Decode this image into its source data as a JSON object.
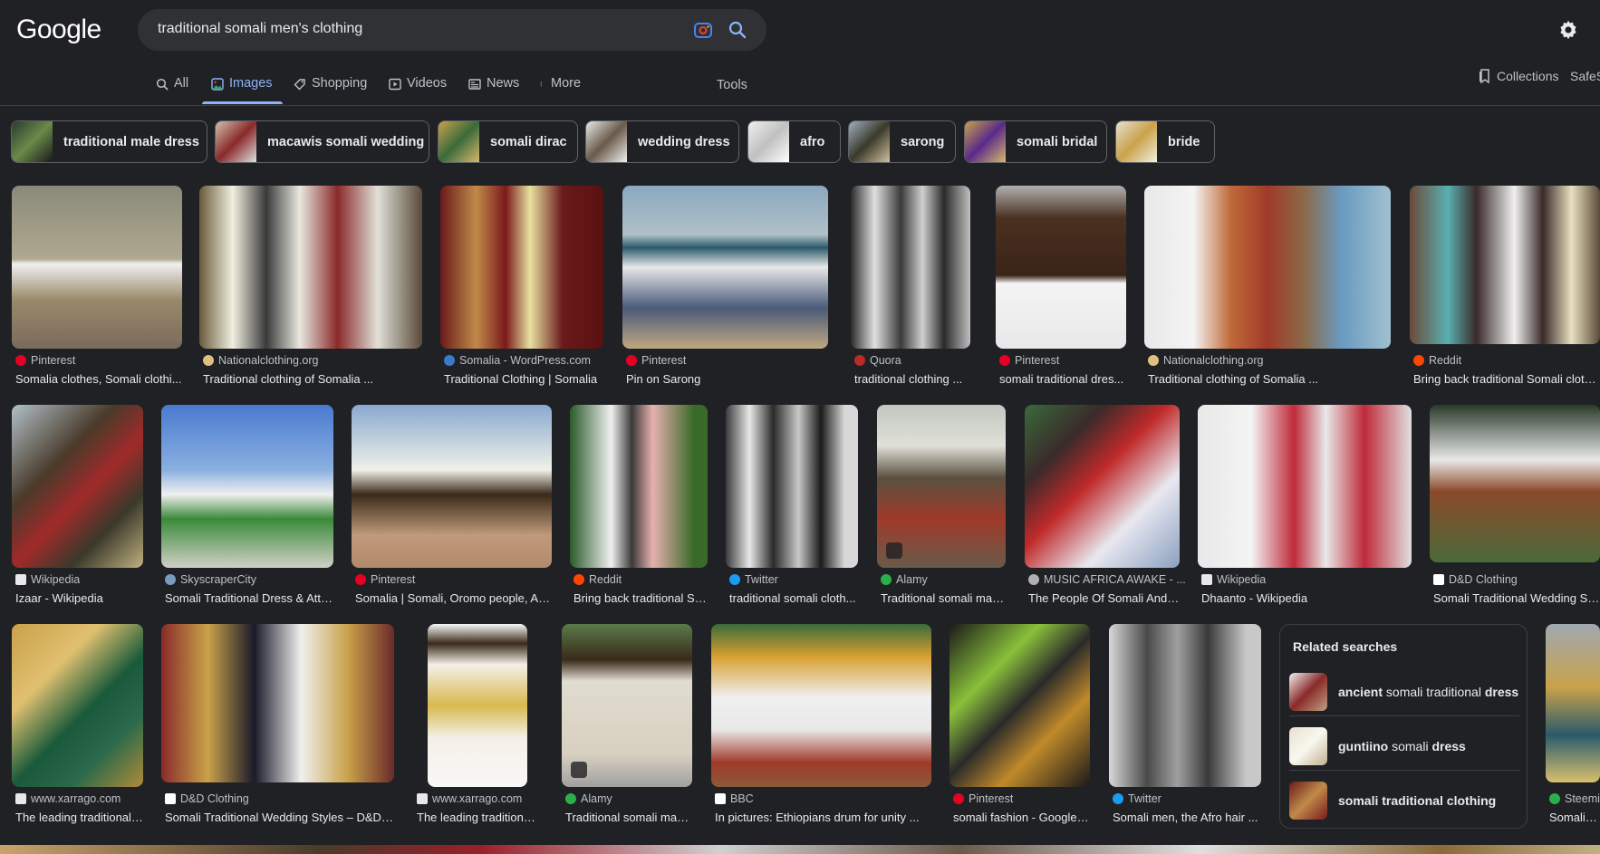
{
  "header": {
    "logo": "Google",
    "query": "traditional somali men's clothing",
    "icons": [
      "google-lens-icon",
      "search-icon",
      "settings-gear-icon"
    ]
  },
  "tabs": [
    {
      "label": "All",
      "icon": "search-icon"
    },
    {
      "label": "Images",
      "icon": "image-icon",
      "active": true
    },
    {
      "label": "Shopping",
      "icon": "tag-icon"
    },
    {
      "label": "Videos",
      "icon": "play-icon"
    },
    {
      "label": "News",
      "icon": "newspaper-icon"
    },
    {
      "label": "More",
      "icon": "dots-vertical-icon"
    }
  ],
  "tools_label": "Tools",
  "collections_label": "Collections",
  "safesearch_label": "SafeS",
  "chips": [
    {
      "label": "traditional male dress"
    },
    {
      "label": "macawis somali wedding"
    },
    {
      "label": "somali dirac"
    },
    {
      "label": "wedding dress"
    },
    {
      "label": "afro"
    },
    {
      "label": "sarong"
    },
    {
      "label": "somali bridal"
    },
    {
      "label": "bride"
    }
  ],
  "results": [
    {
      "source": "Pinterest",
      "title": "Somalia clothes, Somali clothi..."
    },
    {
      "source": "Nationalclothing.org",
      "title": "Traditional clothing of Somalia ..."
    },
    {
      "source": "Somalia - WordPress.com",
      "title": "Traditional Clothing | Somalia"
    },
    {
      "source": "Pinterest",
      "title": "Pin on Sarong"
    },
    {
      "source": "Quora",
      "title": "traditional clothing ..."
    },
    {
      "source": "Pinterest",
      "title": "somali traditional dres..."
    },
    {
      "source": "Nationalclothing.org",
      "title": "Traditional clothing of Somalia ..."
    },
    {
      "source": "Reddit",
      "title": "Bring back traditional Somali clothing"
    },
    {
      "source": "Wikipedia",
      "title": "Izaar - Wikipedia"
    },
    {
      "source": "SkyscraperCity",
      "title": "Somali Traditional Dress & Attir..."
    },
    {
      "source": "Pinterest",
      "title": "Somalia | Somali, Oromo people, Afri..."
    },
    {
      "source": "Reddit",
      "title": "Bring back traditional So..."
    },
    {
      "source": "Twitter",
      "title": "traditional somali cloth..."
    },
    {
      "source": "Alamy",
      "title": "Traditional somali man..."
    },
    {
      "source": "MUSIC AFRICA AWAKE - ...",
      "title": "The People Of Somali And T..."
    },
    {
      "source": "Wikipedia",
      "title": "Dhaanto - Wikipedia"
    },
    {
      "source": "D&D Clothing",
      "title": "Somali Traditional Wedding Styles"
    },
    {
      "source": "www.xarrago.com",
      "title": "The leading traditional ..."
    },
    {
      "source": "D&D Clothing",
      "title": "Somali Traditional Wedding Styles – D&D ..."
    },
    {
      "source": "www.xarrago.com",
      "title": "The leading traditional ..."
    },
    {
      "source": "Alamy",
      "title": "Traditional somali man..."
    },
    {
      "source": "BBC",
      "title": "In pictures: Ethiopians drum for unity ..."
    },
    {
      "source": "Pinterest",
      "title": "somali fashion - Google S..."
    },
    {
      "source": "Twitter",
      "title": "Somali men, the Afro hair ..."
    },
    {
      "source": "Steemi",
      "title": "Somali we"
    }
  ],
  "related": {
    "heading": "Related searches",
    "items": [
      {
        "bold1": "ancient",
        "plain": " somali traditional ",
        "bold2": "dress"
      },
      {
        "bold1": "guntiino",
        "plain": " somali ",
        "bold2": "dress"
      },
      {
        "bold1": "",
        "plain": "",
        "bold2": "somali traditional clothing"
      }
    ]
  },
  "colors": {
    "background": "#202124",
    "accent": "#8ab4f8",
    "text": "#e8eaed",
    "muted": "#bdc1c6"
  }
}
